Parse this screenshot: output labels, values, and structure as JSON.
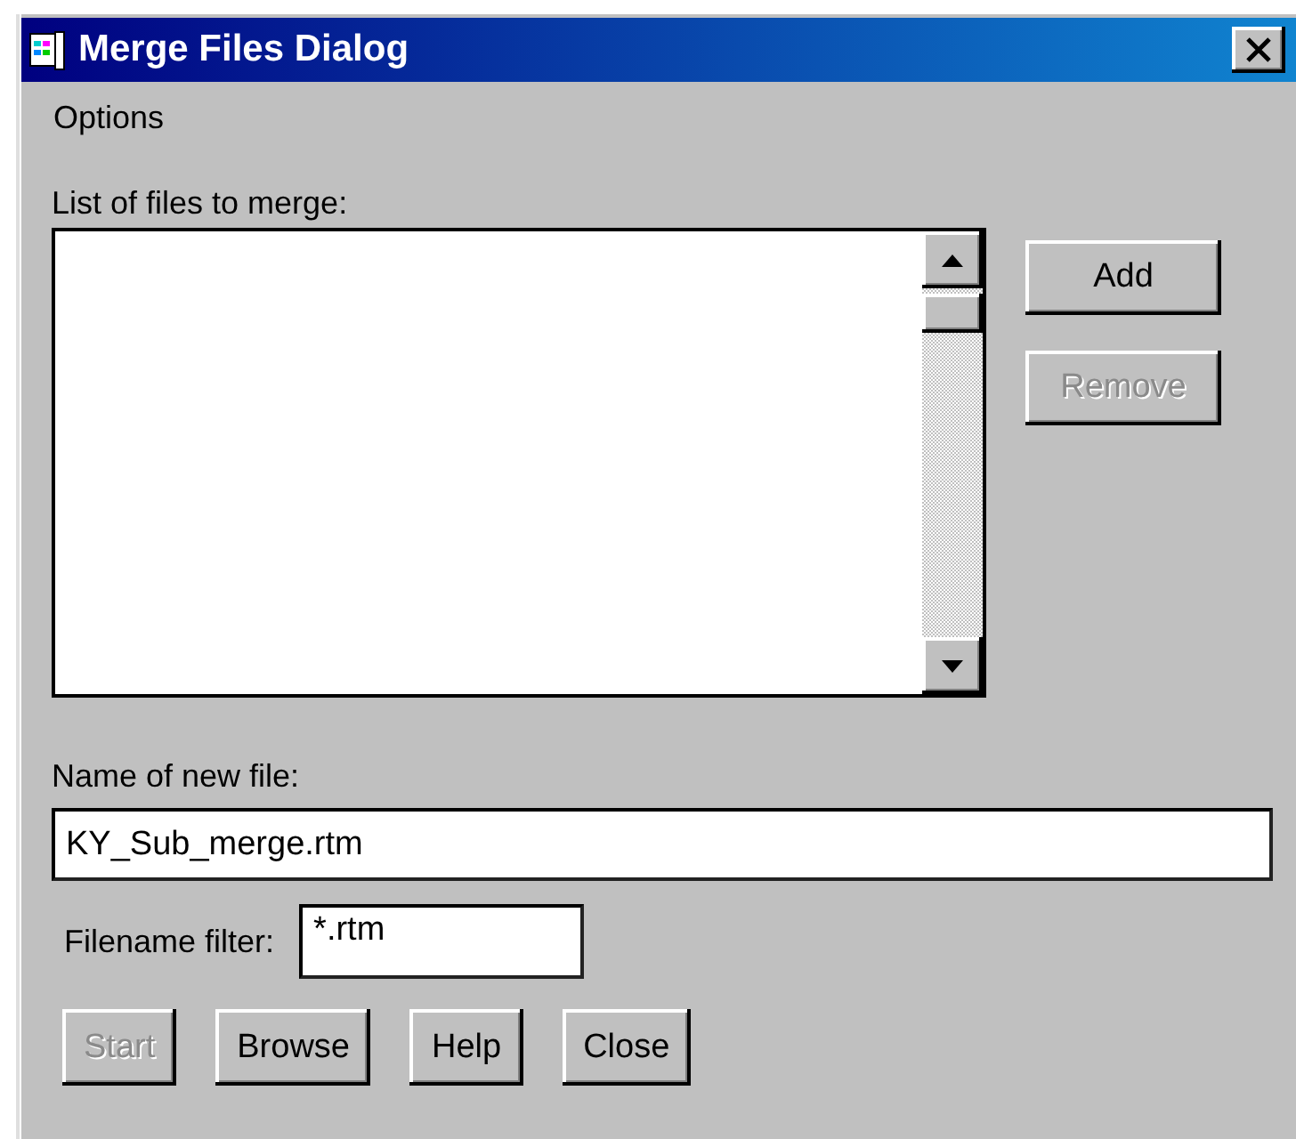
{
  "window": {
    "title": "Merge Files Dialog"
  },
  "menu": [
    {
      "label": "Options"
    }
  ],
  "file_list": {
    "label": "List of files to merge:"
  },
  "side_buttons": [
    {
      "label": "Add",
      "disabled": false
    },
    {
      "label": "Remove",
      "disabled": true
    }
  ],
  "new_file": {
    "label": "Name of new file:",
    "value": "KY_Sub_merge.rtm"
  },
  "filter": {
    "label": "Filename filter:",
    "value": "*.rtm"
  },
  "bottom_buttons": [
    {
      "label": "Start",
      "disabled": true
    },
    {
      "label": "Browse",
      "disabled": false
    },
    {
      "label": "Help",
      "disabled": false
    },
    {
      "label": "Close",
      "disabled": false
    }
  ]
}
